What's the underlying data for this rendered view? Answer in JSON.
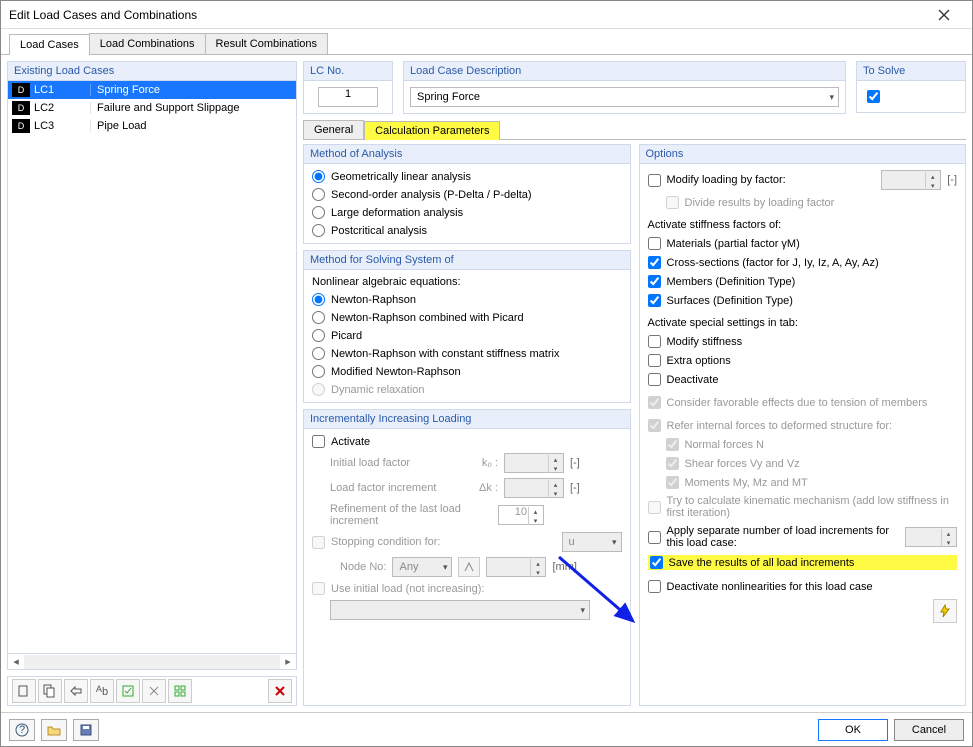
{
  "window": {
    "title": "Edit Load Cases and Combinations"
  },
  "maintabs": {
    "load_cases": "Load Cases",
    "load_combos": "Load Combinations",
    "result_combos": "Result Combinations"
  },
  "left": {
    "header": "Existing Load Cases",
    "rows": [
      {
        "tag": "D",
        "code": "LC1",
        "desc": "Spring Force"
      },
      {
        "tag": "D",
        "code": "LC2",
        "desc": "Failure and Support Slippage"
      },
      {
        "tag": "D",
        "code": "LC3",
        "desc": "Pipe Load"
      }
    ]
  },
  "top": {
    "lcno_label": "LC No.",
    "lcno_value": "1",
    "desc_label": "Load Case Description",
    "desc_value": "Spring Force",
    "tosolve_label": "To Solve"
  },
  "subtabs": {
    "general": "General",
    "calc": "Calculation Parameters"
  },
  "method": {
    "title": "Method of Analysis",
    "opt1": "Geometrically linear analysis",
    "opt2": "Second-order analysis (P-Delta / P-delta)",
    "opt3": "Large deformation analysis",
    "opt4": "Postcritical analysis"
  },
  "solving": {
    "title": "Method for Solving System of",
    "sub": "Nonlinear algebraic equations:",
    "opt1": "Newton-Raphson",
    "opt2": "Newton-Raphson combined with Picard",
    "opt3": "Picard",
    "opt4": "Newton-Raphson with constant stiffness matrix",
    "opt5": "Modified Newton-Raphson",
    "opt6": "Dynamic relaxation"
  },
  "incr": {
    "title": "Incrementally Increasing Loading",
    "activate": "Activate",
    "initial": "Initial load factor",
    "initial_sym": "k₀ :",
    "increment": "Load factor increment",
    "increment_sym": "Δk :",
    "refine": "Refinement of the last load increment",
    "refine_val": "10",
    "stopping": "Stopping condition for:",
    "stopping_val": "u",
    "nodeno": "Node No:",
    "nodeno_val": "Any",
    "mm": "[mm]",
    "useinitial": "Use initial load (not increasing):",
    "dash": "[-]"
  },
  "options": {
    "title": "Options",
    "modify": "Modify loading by factor:",
    "divide": "Divide results by loading factor",
    "activate_stiff": "Activate stiffness factors of:",
    "materials": "Materials (partial factor γM)",
    "cross": "Cross-sections (factor for J, Iy, Iz, A, Ay, Az)",
    "members": "Members (Definition Type)",
    "surfaces": "Surfaces (Definition Type)",
    "special": "Activate special settings in tab:",
    "mod_stiff": "Modify stiffness",
    "extra": "Extra options",
    "deact": "Deactivate",
    "favorable": "Consider favorable effects due to tension of members",
    "refer": "Refer internal forces to deformed structure for:",
    "normal": "Normal forces N",
    "shear": "Shear forces Vy and Vz",
    "moments": "Moments My, Mz and MT",
    "kinematic": "Try to calculate kinematic mechanism (add low stiffness in first iteration)",
    "separate": "Apply separate number of load increments for this load case:",
    "save": "Save the results of all load increments",
    "deact_nonlin": "Deactivate nonlinearities for this load case",
    "dash": "[-]"
  },
  "footer": {
    "ok": "OK",
    "cancel": "Cancel"
  }
}
